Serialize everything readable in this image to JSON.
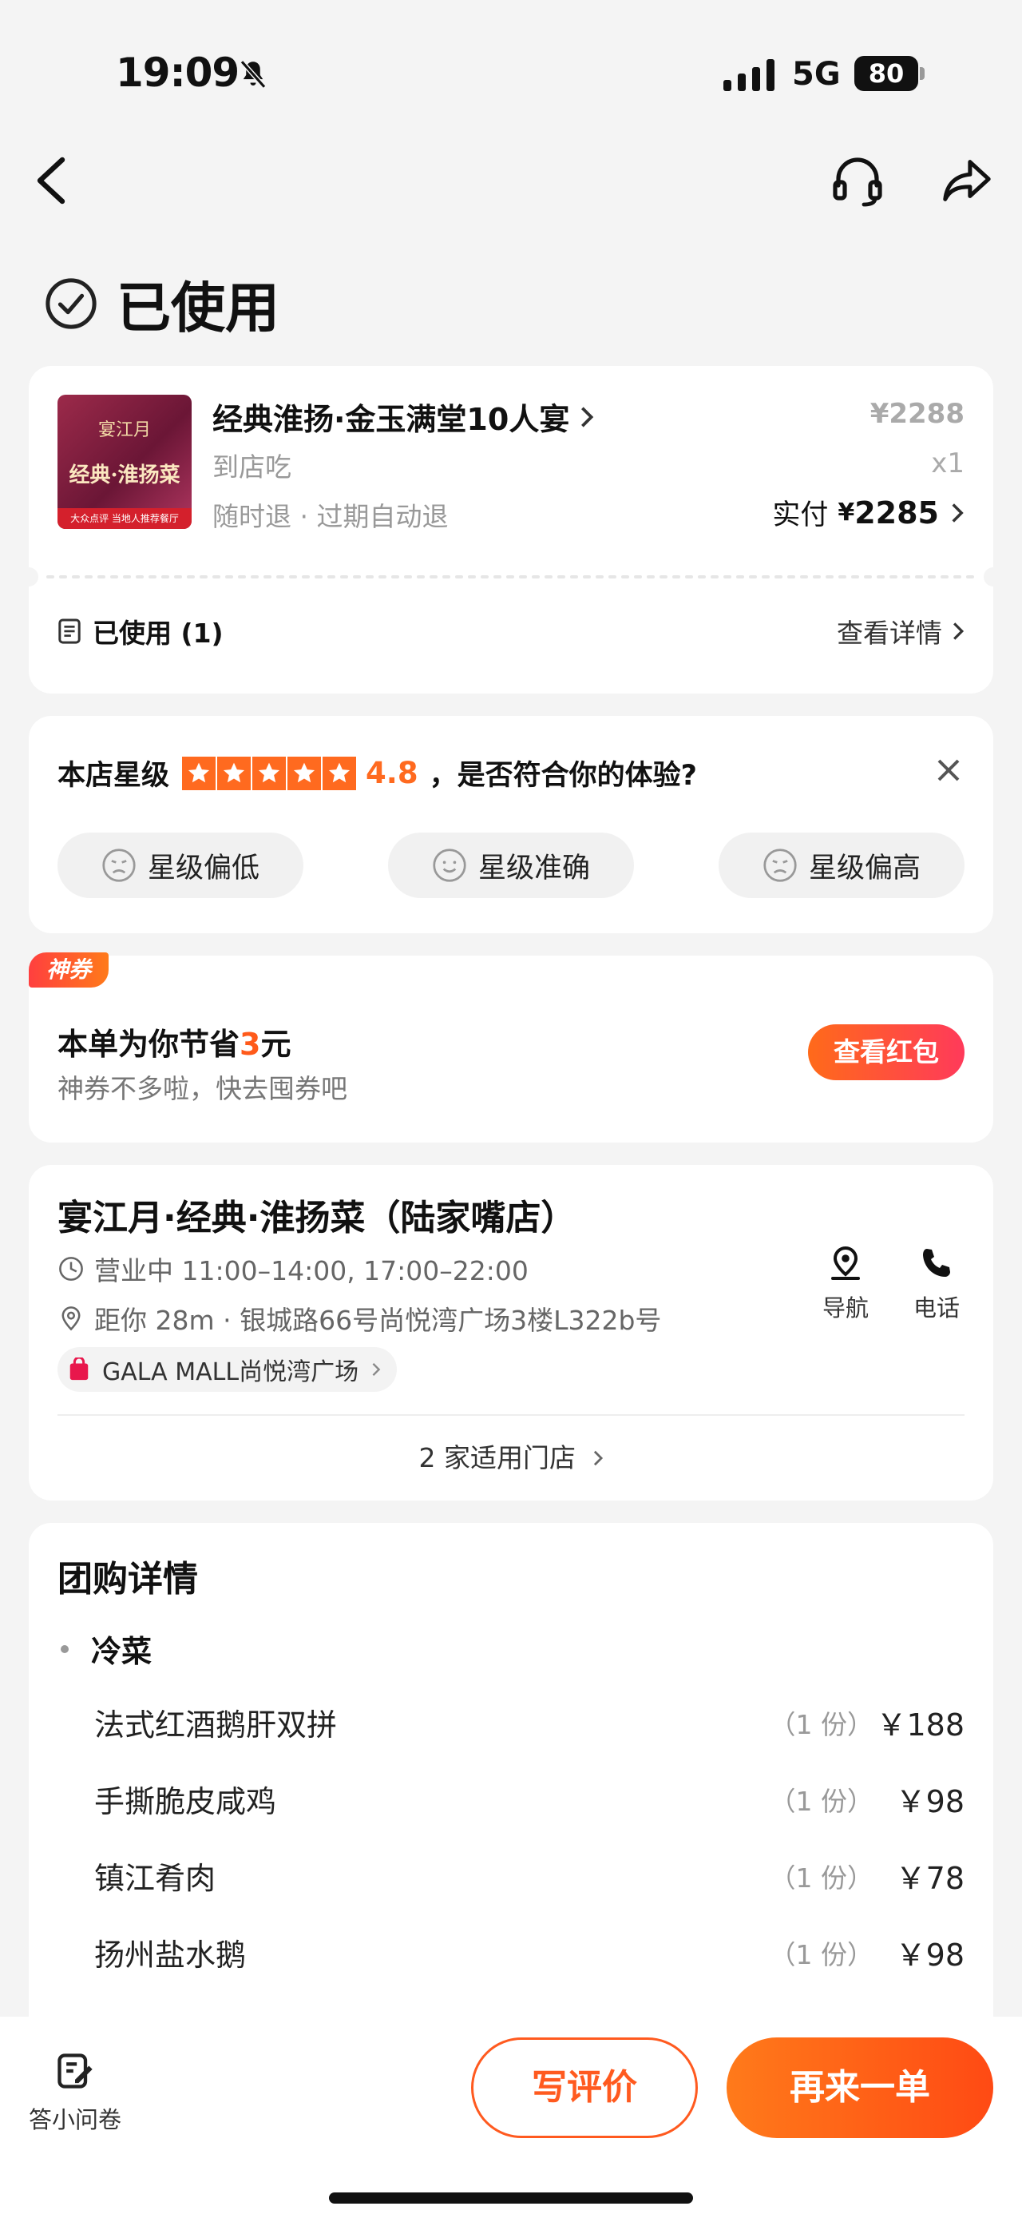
{
  "status_bar": {
    "time": "19:09",
    "network": "5G",
    "battery": "80"
  },
  "page": {
    "status_title": "已使用"
  },
  "order": {
    "title": "经典淮扬·金玉满堂10人宴",
    "type": "到店吃",
    "policy": "随时退 · 过期自动退",
    "original_price": "¥2288",
    "quantity": "x1",
    "paid_label": "实付",
    "paid_currency": "¥",
    "paid_amount": "2285",
    "used_label": "已使用 (1)",
    "detail_link": "查看详情",
    "thumb": {
      "brand": "宴江月",
      "tagline": "经典·淮扬菜",
      "ribbon": "大众点评 当地人推荐餐厅"
    }
  },
  "rating": {
    "label": "本店星级",
    "stars": 5,
    "score": "4.8",
    "question": "，是否符合你的体验?",
    "options": [
      "星级偏低",
      "星级准确",
      "星级偏高"
    ]
  },
  "coupon": {
    "badge": "神券",
    "title_prefix": "本单为你节省",
    "amount": "3",
    "title_suffix": "元",
    "subtitle": "神券不多啦，快去囤券吧",
    "button": "查看红包"
  },
  "store": {
    "name": "宴江月·经典·淮扬菜（陆家嘴店）",
    "hours": "营业中 11:00–14:00, 17:00–22:00",
    "address": "距你 28m ·  银城路66号尚悦湾广场3楼L322b号",
    "mall": "GALA MALL尚悦湾广场",
    "nav_label": "导航",
    "phone_label": "电话",
    "store_count": "2 家适用门店"
  },
  "group_detail": {
    "title": "团购详情",
    "category": "冷菜",
    "dishes": [
      {
        "name": "法式红酒鹅肝双拼",
        "qty": "（1 份）",
        "price": "￥188"
      },
      {
        "name": "手撕脆皮咸鸡",
        "qty": "（1 份）",
        "price": "￥98"
      },
      {
        "name": "镇江肴肉",
        "qty": "（1 份）",
        "price": "￥78"
      },
      {
        "name": "扬州盐水鹅",
        "qty": "（1 份）",
        "price": "￥98"
      }
    ]
  },
  "bottom": {
    "survey": "答小问卷",
    "review": "写评价",
    "reorder": "再来一单"
  },
  "colors": {
    "accent": "#ff5a1f",
    "star": "#ff6a1f",
    "background": "#f4f4f4"
  }
}
